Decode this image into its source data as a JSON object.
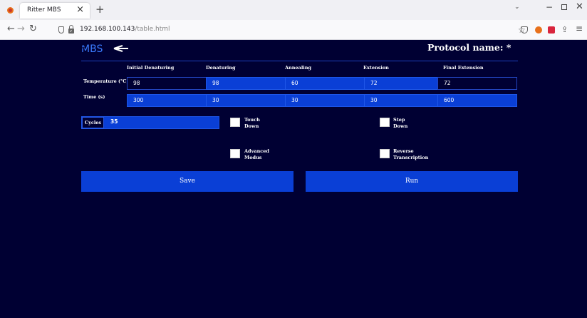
{
  "browser": {
    "tab_title": "Ritter MBS",
    "tab_close": "×",
    "new_tab": "+",
    "tabs_list": "⌄",
    "url_host": "192.168.100.143",
    "url_path": "/table.html"
  },
  "app": {
    "logo_text": "MBS",
    "protocol_name_label": "Protocol name: *",
    "columns": [
      "Initial Denaturing",
      "Denaturing",
      "Annealing",
      "Extension",
      "Final Extension"
    ],
    "rows": [
      {
        "label": "Temperature (°C)",
        "values": [
          "98",
          "98",
          "60",
          "72",
          "72"
        ]
      },
      {
        "label": "Time (s)",
        "values": [
          "300",
          "30",
          "30",
          "30",
          "600"
        ]
      }
    ],
    "cycles": {
      "label": "Cycles",
      "value": "35"
    },
    "options": {
      "touch_down": [
        "Touch",
        "Down"
      ],
      "step_down": [
        "Step",
        "Down"
      ],
      "advanced_modus": [
        "Advanced",
        "Modus"
      ],
      "reverse_transcription": [
        "Reverse",
        "Transcription"
      ]
    },
    "save_label": "Save",
    "run_label": "Run"
  },
  "colors": {
    "page_bg": "#000033",
    "accent_blue": "#0a3fd6",
    "logo_blue": "#3a7bff"
  }
}
